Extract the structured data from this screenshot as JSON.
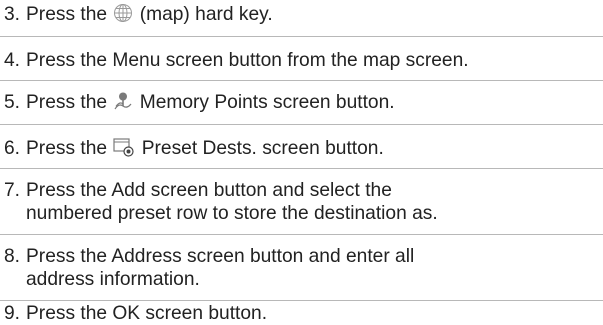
{
  "steps": [
    {
      "num": "3.",
      "before": "Press the ",
      "icon": "globe-icon",
      "after": " (map) hard key."
    },
    {
      "num": "4.",
      "text": "Press the Menu screen button from the map screen."
    },
    {
      "num": "5.",
      "before": "Press the ",
      "icon": "memory-points-icon",
      "after": " Memory Points screen button."
    },
    {
      "num": "6.",
      "before": "Press the ",
      "icon": "preset-dests-icon",
      "after": " Preset Dests. screen button."
    },
    {
      "num": "7.",
      "line1": "Press the Add screen button and select the",
      "line2": "numbered preset row to store the destination as."
    },
    {
      "num": "8.",
      "line1": "Press the Address screen button and enter all",
      "line2": "address information."
    },
    {
      "num": "9.",
      "text": "Press the OK screen button."
    }
  ],
  "colors": {
    "text": "#222222",
    "icon": "#9a9a9a",
    "divider": "#b8b8b8"
  }
}
